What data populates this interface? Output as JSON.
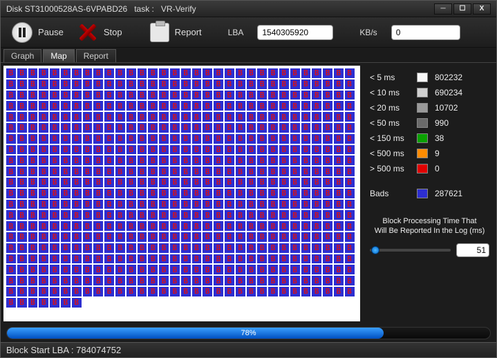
{
  "title": {
    "disk": "Disk ST31000528AS-6VPABD26",
    "sep": "task :",
    "task": "VR-Verify"
  },
  "winbuttons": {
    "min": "─",
    "max": "☐",
    "close": "X"
  },
  "toolbar": {
    "pause": "Pause",
    "stop": "Stop",
    "report": "Report",
    "lba_label": "LBA",
    "lba_value": "1540305920",
    "kbs_label": "KB/s",
    "kbs_value": "0"
  },
  "tabs": {
    "graph": "Graph",
    "map": "Map",
    "report": "Report",
    "active": "map"
  },
  "legend": {
    "rows": [
      {
        "label": "< 5 ms",
        "color": "#f8f8f8",
        "count": "802232"
      },
      {
        "label": "< 10 ms",
        "color": "#d0d0d0",
        "count": "690234"
      },
      {
        "label": "< 20 ms",
        "color": "#9a9a9a",
        "count": "10702"
      },
      {
        "label": "< 50 ms",
        "color": "#6a6a6a",
        "count": "990"
      },
      {
        "label": "< 150 ms",
        "color": "#0aa000",
        "count": "38"
      },
      {
        "label": "< 500 ms",
        "color": "#ff8c00",
        "count": "9"
      },
      {
        "label": "> 500 ms",
        "color": "#e00000",
        "count": "0"
      }
    ],
    "bads": {
      "label": "Bads",
      "color": "#2d2ed0",
      "count": "287621"
    }
  },
  "slider": {
    "caption1": "Block Processing Time That",
    "caption2": "Will Be Reported In the Log (ms)",
    "value": "51"
  },
  "progress": {
    "percent": 78,
    "text": "78%"
  },
  "status": {
    "prefix": "Block Start LBA :",
    "value": "784074752"
  },
  "map": {
    "full_rows": 21,
    "cols": 32,
    "last_row_cells": 7,
    "cell_glyph": "B"
  }
}
